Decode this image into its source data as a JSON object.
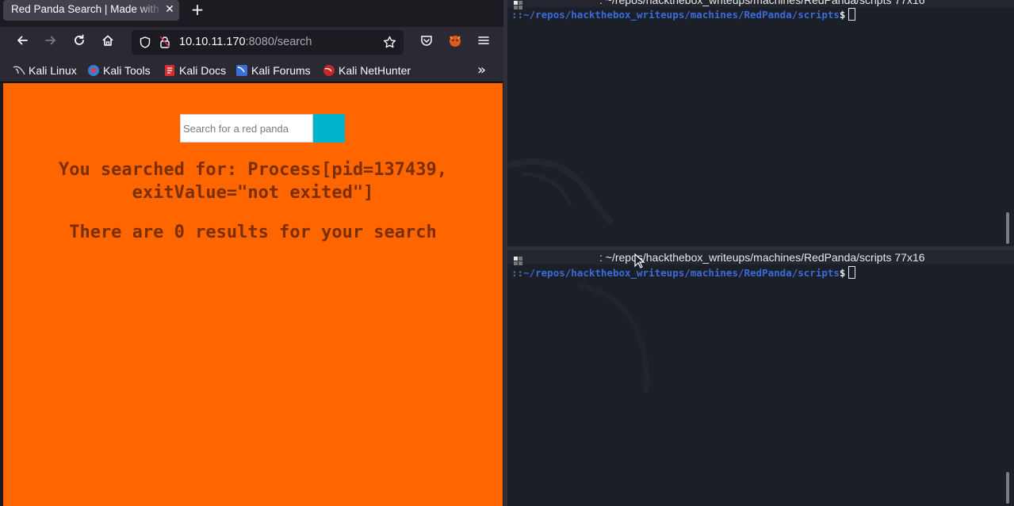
{
  "browser": {
    "tab": {
      "title": "Red Panda Search | Made with",
      "close_icon": "close-icon"
    },
    "new_tab_icon": "plus-icon",
    "nav": {
      "back_icon": "arrow-left-icon",
      "forward_icon": "arrow-right-icon",
      "reload_icon": "reload-icon",
      "home_icon": "home-icon"
    },
    "url": {
      "host": "10.10.11.170",
      "rest": ":8080/search"
    },
    "bookmarks": [
      {
        "label": "Kali Linux",
        "icon": "kali-dragon-icon"
      },
      {
        "label": "Kali Tools",
        "icon": "kali-tools-icon"
      },
      {
        "label": "Kali Docs",
        "icon": "kali-docs-icon"
      },
      {
        "label": "Kali Forums",
        "icon": "kali-forums-icon"
      },
      {
        "label": "Kali NetHunter",
        "icon": "kali-nethunter-icon"
      }
    ],
    "page": {
      "search_placeholder": "Search for a red panda",
      "searched_for_line1": "You searched for: Process[pid=137439,",
      "searched_for_line2": "exitValue=\"not exited\"]",
      "results": "There are 0 results for your search"
    },
    "colors": {
      "page_bg": "#ff6600",
      "heading": "#7b2e00",
      "search_button": "#00b4cc"
    }
  },
  "terminal": {
    "top": {
      "title": ": ~/repos/hackthebox_writeups/machines/RedPanda/scripts 77x16",
      "prompt_sep": "::",
      "prompt_path": "~/repos/hackthebox_writeups/machines/RedPanda/scripts",
      "prompt_symbol": "$"
    },
    "bottom": {
      "title": ": ~/repos/hackthebox_writeups/machines/RedPanda/scripts 77x16",
      "prompt_sep": "::",
      "prompt_path": "~/repos/hackthebox_writeups/machines/RedPanda/scripts",
      "prompt_symbol": "$"
    }
  }
}
